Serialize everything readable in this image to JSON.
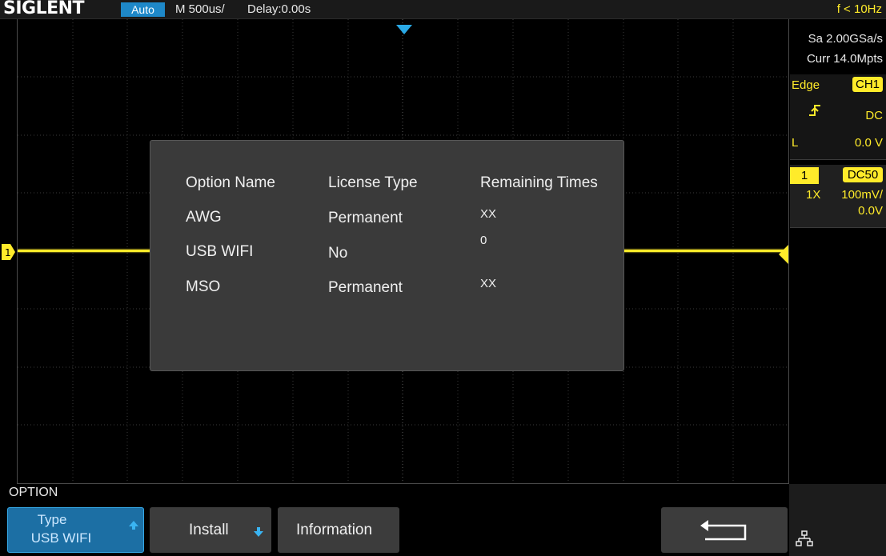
{
  "header": {
    "brand": "SIGLENT",
    "trigger_mode": "Auto",
    "timebase": "M 500us/",
    "delay": "Delay:0.00s",
    "frequency": "f < 10Hz"
  },
  "status_panel": {
    "sample_rate": "Sa 2.00GSa/s",
    "memory_depth": "Curr 14.0Mpts",
    "trigger": {
      "type": "Edge",
      "source": "CH1",
      "slope_icon": "rising-edge-icon",
      "coupling": "DC",
      "level_prefix": "L",
      "level": "0.0 V"
    },
    "channel": {
      "number": "1",
      "coupling": "DC50",
      "probe": "1X",
      "scale": "100mV/",
      "offset": "0.0V"
    }
  },
  "dialog": {
    "headers": [
      "Option Name",
      "License Type",
      "Remaining Times"
    ],
    "rows": [
      {
        "name": "AWG",
        "license": "Permanent",
        "remaining": "XX"
      },
      {
        "name": "USB WIFI",
        "license": "No",
        "remaining": "0"
      },
      {
        "name": "MSO",
        "license": "Permanent",
        "remaining": "XX"
      }
    ]
  },
  "menu": {
    "title": "OPTION",
    "type_button": {
      "label": "Type",
      "value": "USB WIFI"
    },
    "install_button": {
      "label": "Install"
    },
    "information_button": {
      "label": "Information"
    },
    "back_button_icon": "return-arrow-icon",
    "network_icon": "network-icon"
  },
  "colors": {
    "channel1": "#ffeb2a",
    "accent": "#1e88c8",
    "trigger_marker": "#2aa9e6",
    "dialog_bg": "#3a3a3a"
  }
}
